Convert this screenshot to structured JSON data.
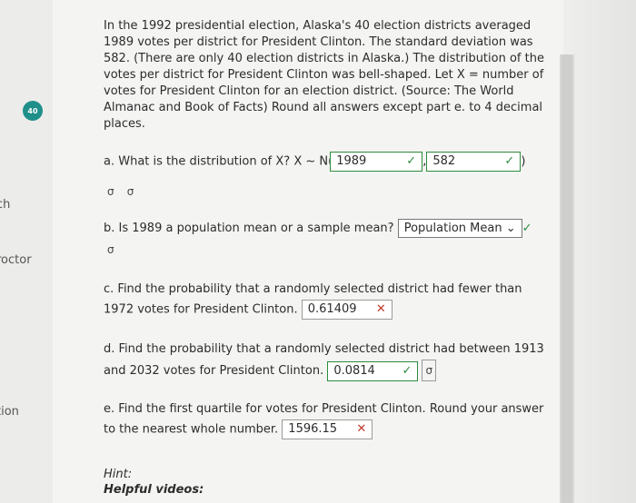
{
  "side": {
    "badge": "40",
    "labels": [
      "ch",
      "roctor",
      "tion"
    ]
  },
  "intro": "In the 1992 presidential election, Alaska's 40 election districts averaged 1989 votes per district for President Clinton. The standard deviation was 582. (There are only 40 election districts in Alaska.) The distribution of the votes per district for President Clinton was bell-shaped. Let X = number of votes for President Clinton for an election district. (Source: The World Almanac and Book of Facts) Round all answers except part e. to 4 decimal places.",
  "qa": {
    "text": "a. What is the distribution of X? X ~ N(",
    "mean_value": "1989",
    "sep": ",",
    "sd_value": "582",
    "close": ")",
    "icon_label": "σ"
  },
  "qb": {
    "text": "b. Is 1989 a population mean or a sample mean?",
    "selected": "Population Mean",
    "arrow": "⌄",
    "icon_label": "σ"
  },
  "qc": {
    "text": "c. Find the probability that a randomly selected district had fewer than 1972 votes for President Clinton.",
    "value": "0.61409"
  },
  "qd": {
    "text": "d. Find the probability that a randomly selected district had between 1913 and 2032 votes for President Clinton.",
    "value": "0.0814",
    "icon_label": "σ"
  },
  "qe": {
    "text": "e. Find the first quartile for votes for President Clinton. Round your answer to the nearest whole number.",
    "value": "1596.15"
  },
  "hint": {
    "label": "Hint:",
    "helpful": "Helpful videos:"
  },
  "marks": {
    "check": "✓",
    "cross": "✕"
  },
  "colors": {
    "badge": "#1f8f8a",
    "correct": "#2e8b3c",
    "wrong": "#c0392b"
  }
}
